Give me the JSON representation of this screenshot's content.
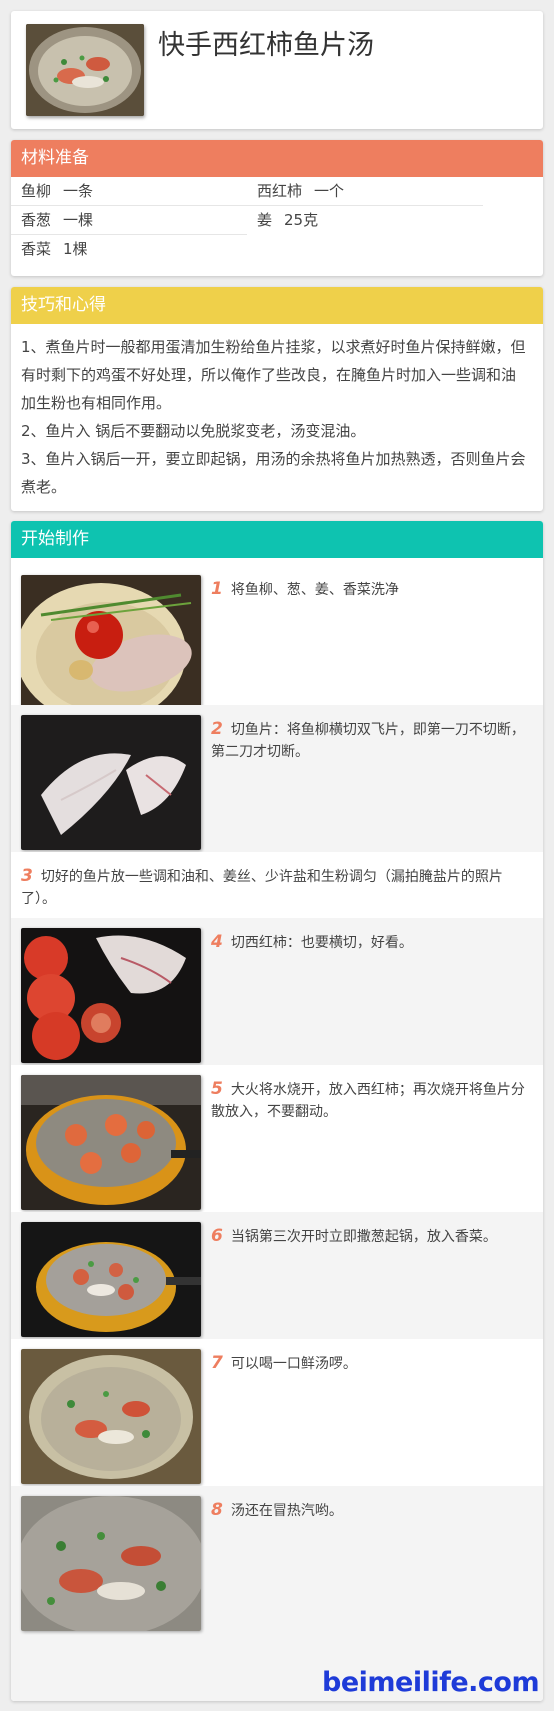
{
  "title": "快手西红柿鱼片汤",
  "ingredients": {
    "header": "材料准备",
    "items": [
      {
        "name": "鱼柳",
        "amount": "一条"
      },
      {
        "name": "西红柿",
        "amount": "一个"
      },
      {
        "name": "香葱",
        "amount": "一棵"
      },
      {
        "name": "姜",
        "amount": "25克"
      },
      {
        "name": "香菜",
        "amount": "1棵"
      }
    ]
  },
  "tips": {
    "header": "技巧和心得",
    "paragraphs": [
      "1、煮鱼片时一般都用蛋清加生粉给鱼片挂浆，以求煮好时鱼片保持鲜嫩，但有时剩下的鸡蛋不好处理，所以俺作了些改良，在腌鱼片时加入一些调和油加生粉也有相同作用。",
      "2、鱼片入 锅后不要翻动以免脱浆变老，汤变混油。",
      "3、鱼片入锅后一开，要立即起锅，用汤的余热将鱼片加热熟透，否则鱼片会煮老。"
    ]
  },
  "steps": {
    "header": "开始制作",
    "items": [
      {
        "num": "1",
        "text": "将鱼柳、葱、姜、香菜洗净",
        "photo": "fish-tomato-plate-photo"
      },
      {
        "num": "2",
        "text": "切鱼片：将鱼柳横切双飞片，即第一刀不切断，第二刀才切断。",
        "photo": "sliced-fish-photo"
      },
      {
        "num": "3",
        "text": "切好的鱼片放一些调和油和、姜丝、少许盐和生粉调匀（漏拍腌盐片的照片了）。",
        "photo": ""
      },
      {
        "num": "4",
        "text": "切西红柿：也要横切，好看。",
        "photo": "sliced-tomato-photo"
      },
      {
        "num": "5",
        "text": "大火将水烧开，放入西红柿；再次烧开将鱼片分散放入，不要翻动。",
        "photo": "tomato-pot-photo"
      },
      {
        "num": "6",
        "text": "当锅第三次开时立即撒葱起锅，放入香菜。",
        "photo": "soup-pot-photo"
      },
      {
        "num": "7",
        "text": "可以喝一口鲜汤啰。",
        "photo": "soup-bowl-photo"
      },
      {
        "num": "8",
        "text": "汤还在冒热汽哟。",
        "photo": "steaming-soup-photo"
      }
    ]
  },
  "watermark": "beimeilife.com"
}
